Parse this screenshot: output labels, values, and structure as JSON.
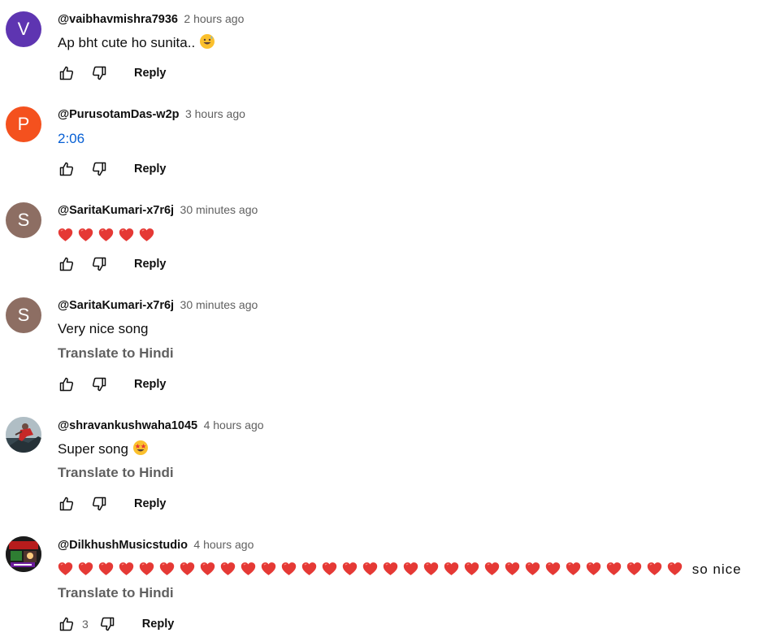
{
  "comments": [
    {
      "avatar_letter": "V",
      "avatar_color": "#5e35b1",
      "author": "@vaibhavmishra7936",
      "time": "2 hours ago",
      "text": "Ap bht cute ho sunita..",
      "text_emoji": "grinning-sweat",
      "reply": "Reply"
    },
    {
      "avatar_letter": "P",
      "avatar_color": "#f4511e",
      "author": "@PurusotamDas-w2p",
      "time": "3 hours ago",
      "text": "2:06",
      "text_is_link": true,
      "reply": "Reply"
    },
    {
      "avatar_letter": "S",
      "avatar_color": "#8d6e63",
      "author": "@SaritaKumari-x7r6j",
      "time": "30 minutes ago",
      "hearts": 5,
      "reply": "Reply"
    },
    {
      "avatar_letter": "S",
      "avatar_color": "#8d6e63",
      "author": "@SaritaKumari-x7r6j",
      "time": "30 minutes ago",
      "text": "Very nice song",
      "translate": "Translate to Hindi",
      "reply": "Reply"
    },
    {
      "avatar_image": "photo-avatar",
      "author": "@shravankushwaha1045",
      "time": "4 hours ago",
      "text": "Super song",
      "text_emoji": "star-struck",
      "translate": "Translate to Hindi",
      "reply": "Reply"
    },
    {
      "avatar_image": "music-studio-avatar",
      "author": "@DilkhushMusicstudio",
      "time": "4 hours ago",
      "hearts": 31,
      "text_after_hearts": " so nice",
      "translate": "Translate to Hindi",
      "like_count": "3",
      "reply": "Reply"
    }
  ],
  "icons": {
    "like": "thumbs-up-icon",
    "dislike": "thumbs-down-icon",
    "heart": "red-heart-emoji"
  },
  "colors": {
    "link": "#065fd4",
    "secondary_text": "#606060",
    "heart": "#e53935"
  }
}
